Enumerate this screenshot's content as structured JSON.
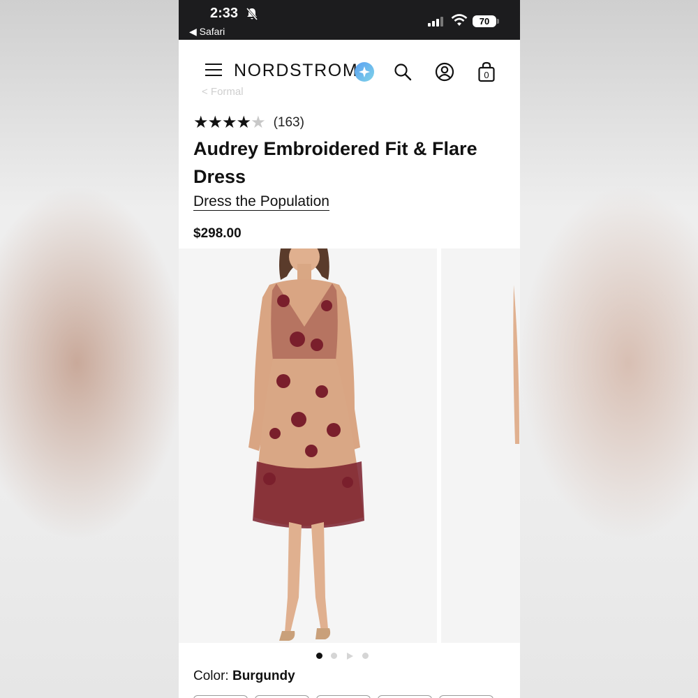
{
  "status_bar": {
    "time": "2:33",
    "back_label": "◀ Safari",
    "battery": "70"
  },
  "header": {
    "logo": "NORDSTROM",
    "icons": [
      "menu-icon",
      "sparkle-icon",
      "search-icon",
      "account-icon",
      "bag-icon"
    ],
    "bag_count": "0"
  },
  "breadcrumb": "< Formal",
  "product": {
    "rating": 4,
    "rating_max": 5,
    "review_count": "(163)",
    "title": "Audrey Embroidered Fit & Flare Dress",
    "brand": "Dress the Population",
    "price": "$298.00"
  },
  "gallery": {
    "image_count": 4,
    "active_index": 0,
    "slide_types": [
      "image",
      "image",
      "video",
      "image"
    ]
  },
  "color": {
    "label": "Color: ",
    "value": "Burgundy"
  },
  "colors": {
    "accent": "#111111",
    "status_bar_bg": "#1c1c1e",
    "dress_burgundy": "#7a1f2c",
    "dress_nude": "#d9a785"
  }
}
